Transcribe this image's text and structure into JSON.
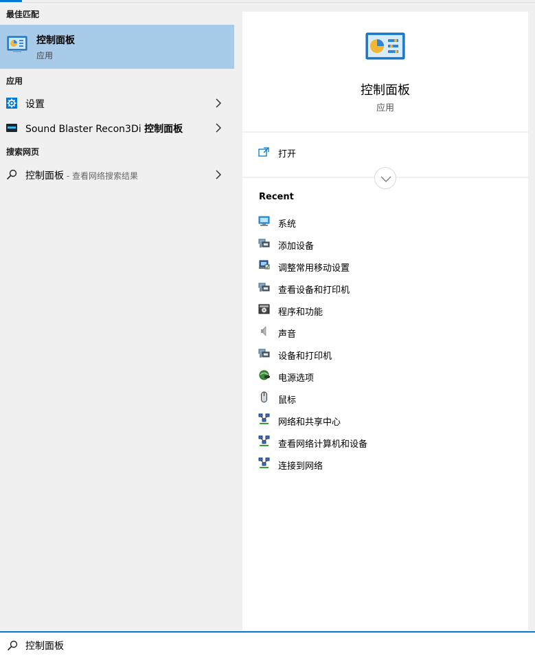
{
  "left": {
    "best_match_header": "最佳匹配",
    "best_match": {
      "title": "控制面板",
      "subtitle": "应用"
    },
    "apps_header": "应用",
    "apps": [
      {
        "label": "设置",
        "icon": "gear-icon"
      },
      {
        "label_prefix": "Sound Blaster Recon3Di ",
        "label_bold": "控制面板",
        "icon": "sound-blaster-icon"
      }
    ],
    "web_header": "搜索网页",
    "web_result": {
      "label": "控制面板",
      "suffix": " - 查看网络搜索结果",
      "icon": "search-icon"
    }
  },
  "right": {
    "title": "控制面板",
    "subtitle": "应用",
    "open_label": "打开",
    "recent_header": "Recent",
    "recent_items": [
      {
        "label": "系统",
        "icon": "system-monitor-icon"
      },
      {
        "label": "添加设备",
        "icon": "devices-printer-icon"
      },
      {
        "label": "调整常用移动设置",
        "icon": "mobility-center-icon"
      },
      {
        "label": "查看设备和打印机",
        "icon": "devices-printer-icon"
      },
      {
        "label": "程序和功能",
        "icon": "programs-icon"
      },
      {
        "label": "声音",
        "icon": "speaker-icon"
      },
      {
        "label": "设备和打印机",
        "icon": "devices-printer-icon"
      },
      {
        "label": "电源选项",
        "icon": "power-options-icon"
      },
      {
        "label": "鼠标",
        "icon": "mouse-icon"
      },
      {
        "label": "网络和共享中心",
        "icon": "network-icon"
      },
      {
        "label": "查看网络计算机和设备",
        "icon": "network-icon"
      },
      {
        "label": "连接到网络",
        "icon": "network-icon"
      }
    ]
  },
  "search": {
    "value": "控制面板"
  },
  "colors": {
    "accent": "#0078d4",
    "selection": "#a9cbea",
    "left_bg": "#f0f0f0"
  }
}
